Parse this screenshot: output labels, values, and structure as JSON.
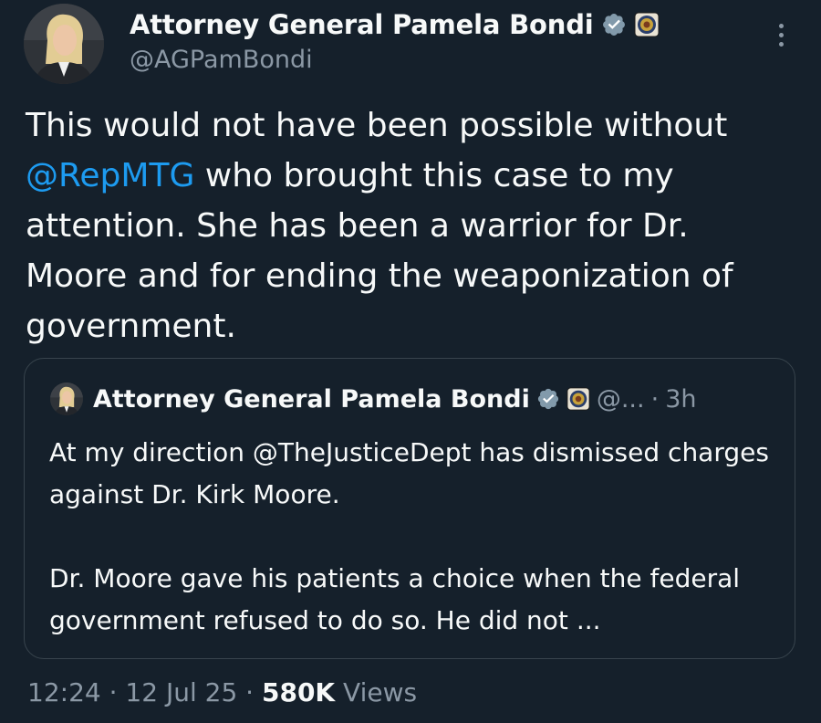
{
  "post": {
    "author": {
      "name": "Attorney General Pamela Bondi",
      "handle": "@AGPamBondi"
    },
    "text": {
      "part1": "This would not have been possible without ",
      "mention": "@RepMTG",
      "part2": " who brought this case to my attention. She has been a warrior for Dr. Moore and for ending the weaponization of government."
    },
    "quoted": {
      "name": "Attorney General Pamela Bondi",
      "handle": "@...",
      "separator": "·",
      "time": "3h",
      "line1": "At my direction @TheJusticeDept has dismissed charges against Dr. Kirk Moore.",
      "line2": "Dr. Moore gave his patients a choice when the federal government refused to do so. He did not ..."
    },
    "meta": {
      "time": "12:24",
      "sep1": "·",
      "date": "12 Jul 25",
      "sep2": "·",
      "views_count": "580K",
      "views_label": "Views"
    }
  },
  "icons": {
    "verified": "verified-badge-icon",
    "affiliate": "doj-seal-icon",
    "more": "more-options-icon"
  },
  "colors": {
    "background": "#15202b",
    "text": "#f7f9f9",
    "muted": "#8b98a5",
    "link": "#1d9bf0",
    "border": "#38444d",
    "verified_badge": "#829aab"
  }
}
